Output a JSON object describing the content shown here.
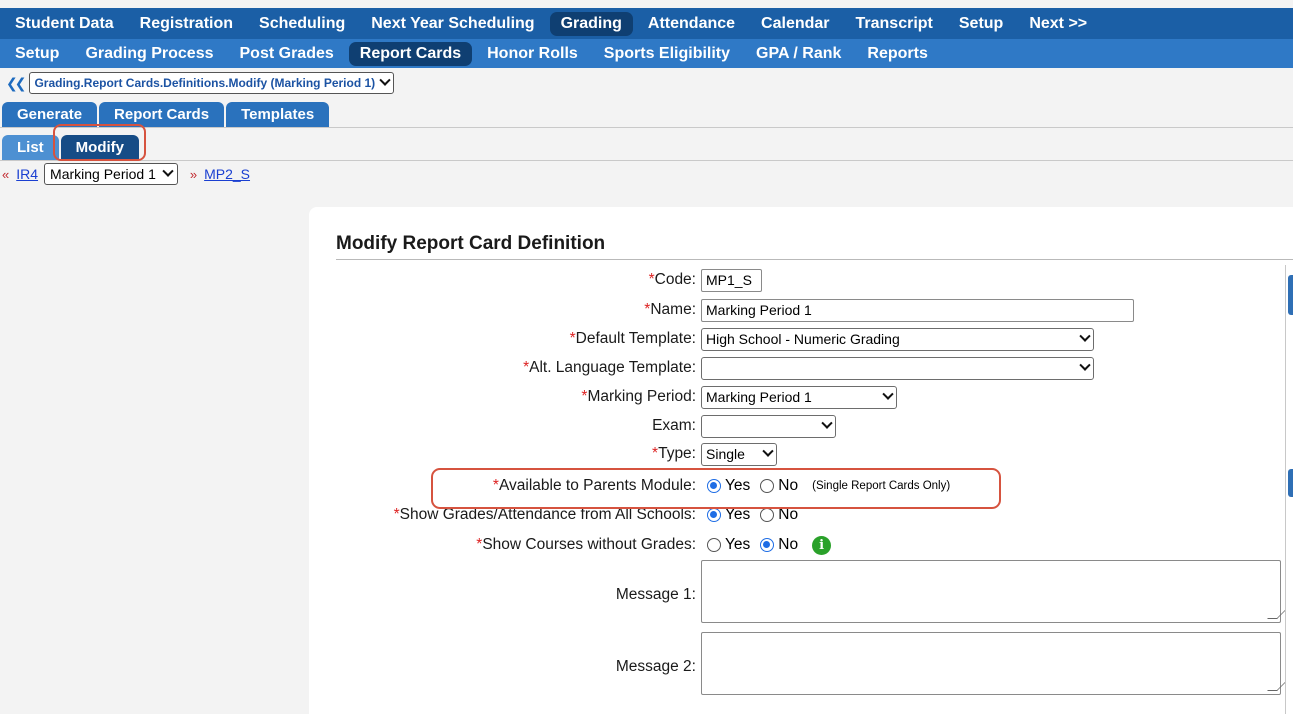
{
  "nav_main": [
    "Student Data",
    "Registration",
    "Scheduling",
    "Next Year Scheduling",
    "Grading",
    "Attendance",
    "Calendar",
    "Transcript",
    "Setup",
    "Next >>"
  ],
  "nav_main_active": "Grading",
  "nav_sub": [
    "Setup",
    "Grading Process",
    "Post Grades",
    "Report Cards",
    "Honor Rolls",
    "Sports Eligibility",
    "GPA / Rank",
    "Reports"
  ],
  "nav_sub_active": "Report Cards",
  "breadcrumb": {
    "current": "Grading.Report Cards.Definitions.Modify (Marking Period 1)"
  },
  "tabs_level1": [
    "Generate",
    "Report Cards",
    "Templates"
  ],
  "tabs_level2": [
    "List",
    "Modify"
  ],
  "record_nav": {
    "prev_code": "IR4",
    "current": "Marking Period 1",
    "next_code": "MP2_S"
  },
  "form": {
    "title": "Modify Report Card Definition",
    "code": {
      "label": "Code:",
      "value": "MP1_S"
    },
    "name": {
      "label": "Name:",
      "value": "Marking Period 1"
    },
    "default_template": {
      "label": "Default Template:",
      "value": "High School - Numeric Grading"
    },
    "alt_language_template": {
      "label": "Alt. Language Template:",
      "value": ""
    },
    "marking_period": {
      "label": "Marking Period:",
      "value": "Marking Period 1"
    },
    "exam": {
      "label": "Exam:",
      "value": ""
    },
    "type": {
      "label": "Type:",
      "value": "Single"
    },
    "available_parents": {
      "label": "Available to Parents Module:",
      "selected": "Yes",
      "yes": "Yes",
      "no": "No",
      "note": "(Single Report Cards Only)"
    },
    "show_grades_all_schools": {
      "label": "Show Grades/Attendance from All Schools:",
      "selected": "Yes",
      "yes": "Yes",
      "no": "No"
    },
    "show_courses_without_grades": {
      "label": "Show Courses without Grades:",
      "selected": "No",
      "yes": "Yes",
      "no": "No"
    },
    "message1": {
      "label": "Message 1:",
      "value": ""
    },
    "message2": {
      "label": "Message 2:",
      "value": ""
    },
    "required_mark": "*"
  },
  "colors": {
    "nav_main": "#1b5fa6",
    "nav_sub": "#2f79c6",
    "highlight": "#d6533f",
    "radio_on": "#1e6de5",
    "info": "#2aa12a"
  }
}
